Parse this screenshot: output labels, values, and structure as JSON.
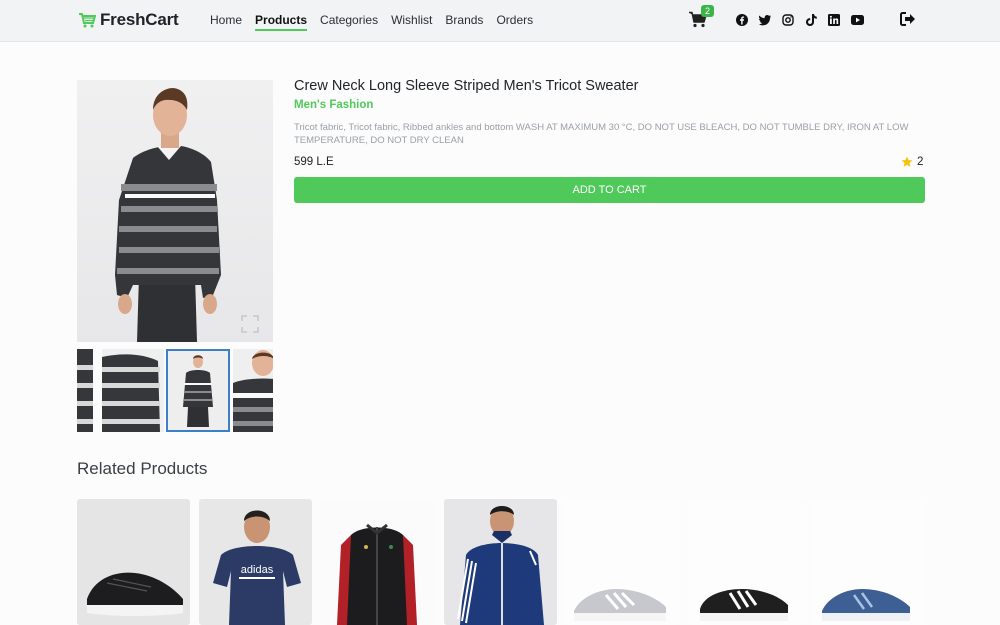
{
  "brand": {
    "name": "FreshCart"
  },
  "nav": {
    "links": [
      "Home",
      "Products",
      "Categories",
      "Wishlist",
      "Brands",
      "Orders"
    ],
    "active": "Products"
  },
  "cart": {
    "count": "2"
  },
  "socials": [
    "facebook-icon",
    "twitter-icon",
    "instagram-icon",
    "tiktok-icon",
    "linkedin-icon",
    "youtube-icon"
  ],
  "product": {
    "title": "Crew Neck Long Sleeve Striped Men's Tricot Sweater",
    "category": "Men's Fashion",
    "description": "Tricot fabric, Tricot fabric, Ribbed ankles and bottom WASH AT MAXIMUM 30 °C, DO NOT USE BLEACH, DO NOT TUMBLE DRY, IRON AT LOW TEMPERATURE, DO NOT DRY CLEAN",
    "price": "599 L.E",
    "rating": "2",
    "add_to_cart_label": "ADD TO CART"
  },
  "related": {
    "heading": "Related Products",
    "items": [
      "black-sneaker",
      "navy-adidas-tshirt",
      "black-track-jacket",
      "navy-track-jacket",
      "grey-running-shoe",
      "black-adidas-shoe",
      "blue-running-shoe"
    ]
  },
  "colors": {
    "accent": "#4fc95a",
    "selected_thumb": "#3d7fc6"
  }
}
